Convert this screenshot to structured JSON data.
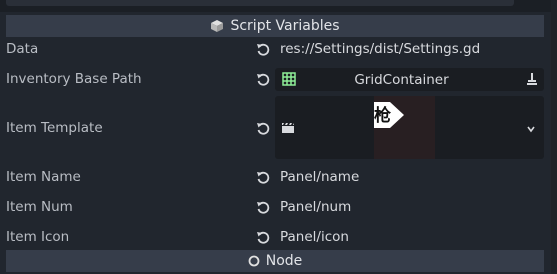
{
  "section": {
    "script_variables": "Script Variables",
    "node": "Node"
  },
  "properties": [
    {
      "label": "Data",
      "value": "res://Settings/dist/Settings.gd"
    },
    {
      "label": "Inventory Base Path",
      "value": "GridContainer"
    },
    {
      "label": "Item Template",
      "value": ""
    },
    {
      "label": "Item Name",
      "value": "Panel/name"
    },
    {
      "label": "Item Num",
      "value": "Panel/num"
    },
    {
      "label": "Item Icon",
      "value": "Panel/icon"
    }
  ],
  "thumbnail_text": "枪",
  "icons": {
    "script_variables": "cube-icon",
    "node": "circle-icon",
    "revert": "revert-icon",
    "grid_container": "grid-container-icon",
    "brush": "brush-icon",
    "scene": "clapperboard-icon",
    "dropdown": "chevron-down-icon"
  },
  "colors": {
    "background": "#21262e",
    "header": "#363d4a",
    "field": "#1a1d22",
    "grid_icon": "#8eef97"
  }
}
